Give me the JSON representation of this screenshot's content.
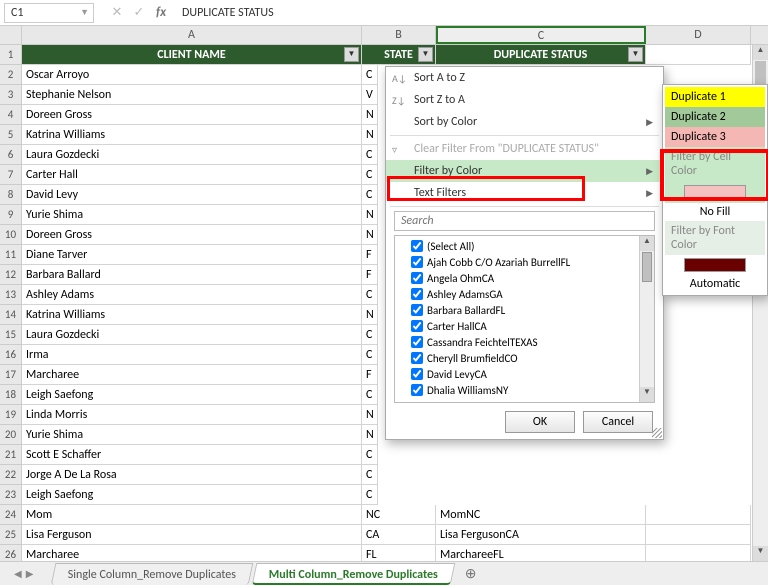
{
  "formula_bar": {
    "cell_ref": "C1",
    "content": "DUPLICATE STATUS"
  },
  "columns": {
    "A": "A",
    "B": "B",
    "C": "C",
    "D": "D"
  },
  "headers": {
    "name": "CLIENT NAME",
    "state": "STATE",
    "dup": "DUPLICATE STATUS"
  },
  "rows": [
    {
      "n": "2",
      "name": "Oscar Arroyo",
      "st": "C"
    },
    {
      "n": "3",
      "name": "Stephanie Nelson",
      "st": "V"
    },
    {
      "n": "4",
      "name": "Doreen Gross",
      "st": "N"
    },
    {
      "n": "5",
      "name": "Katrina Williams",
      "st": "N"
    },
    {
      "n": "6",
      "name": "Laura Gozdecki",
      "st": "C"
    },
    {
      "n": "7",
      "name": "Carter Hall",
      "st": "C"
    },
    {
      "n": "8",
      "name": "David Levy",
      "st": "C"
    },
    {
      "n": "9",
      "name": "Yurie Shima",
      "st": "N"
    },
    {
      "n": "10",
      "name": "Doreen Gross",
      "st": "N"
    },
    {
      "n": "11",
      "name": "Diane Tarver",
      "st": "F"
    },
    {
      "n": "12",
      "name": "Barbara Ballard",
      "st": "F"
    },
    {
      "n": "13",
      "name": "Ashley Adams",
      "st": "C"
    },
    {
      "n": "14",
      "name": "Katrina Williams",
      "st": "N"
    },
    {
      "n": "15",
      "name": "Laura Gozdecki",
      "st": "C"
    },
    {
      "n": "16",
      "name": "Irma",
      "st": "C"
    },
    {
      "n": "17",
      "name": "Marcharee",
      "st": "F"
    },
    {
      "n": "18",
      "name": "Leigh Saefong",
      "st": "C"
    },
    {
      "n": "19",
      "name": "Linda Morris",
      "st": "N"
    },
    {
      "n": "20",
      "name": "Yurie Shima",
      "st": "N"
    },
    {
      "n": "21",
      "name": "Scott E Schaffer",
      "st": "C"
    },
    {
      "n": "22",
      "name": "Jorge A De La Rosa",
      "st": "C"
    },
    {
      "n": "23",
      "name": "Leigh Saefong",
      "st": "C"
    }
  ],
  "bottom_rows": [
    {
      "n": "24",
      "name": "Mom",
      "st": "NC",
      "dup": "MomNC"
    },
    {
      "n": "25",
      "name": "Lisa Ferguson",
      "st": "CA",
      "dup": "Lisa FergusonCA"
    },
    {
      "n": "26",
      "name": "Marcharee",
      "st": "FL",
      "dup": "MarchareeFL"
    }
  ],
  "dropdown": {
    "sort_az": "Sort A to Z",
    "sort_za": "Sort Z to A",
    "sort_color": "Sort by Color",
    "clear": "Clear Filter From \"DUPLICATE STATUS\"",
    "filter_color": "Filter by Color",
    "text_filters": "Text Filters",
    "search_ph": "Search",
    "items": [
      "(Select All)",
      "Ajah Cobb C/O Azariah BurrellFL",
      "Angela OhmCA",
      "Ashley AdamsGA",
      "Barbara BallardFL",
      "Carter HallCA",
      "Cassandra FeichtelTEXAS",
      "Cheryll BrumfieldCO",
      "David LevyCA",
      "Dhalia WilliamsNY"
    ],
    "ok": "OK",
    "cancel": "Cancel"
  },
  "submenu": {
    "dup1": "Duplicate 1",
    "dup2": "Duplicate 2",
    "dup3": "Duplicate 3",
    "by_cell": "Filter by Cell Color",
    "nofill": "No Fill",
    "by_font": "Filter by Font Color",
    "auto": "Automatic"
  },
  "tabs": {
    "t1": "Single Column_Remove Duplicates",
    "t2": "Multi Column_Remove Duplicates"
  }
}
